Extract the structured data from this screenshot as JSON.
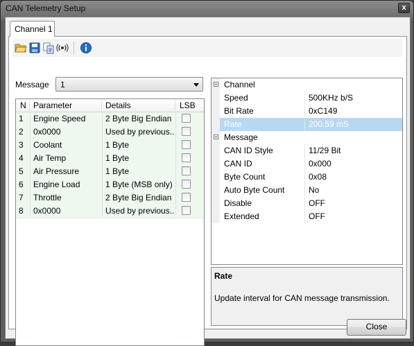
{
  "window": {
    "title": "CAN Telemetry Setup",
    "close_glyph": "x"
  },
  "tabs": [
    {
      "label": "Channel 1",
      "active": true
    }
  ],
  "toolbar": {
    "icons": [
      "open-folder-icon",
      "save-icon",
      "copy-icon",
      "broadcast-icon",
      "info-icon"
    ]
  },
  "message_selector": {
    "label": "Message",
    "value": "1"
  },
  "grid": {
    "columns": [
      "N",
      "Parameter",
      "Details",
      "LSB"
    ],
    "rows": [
      {
        "n": "1",
        "parameter": "Engine Speed",
        "details": "2 Byte Big Endian",
        "lsb": false
      },
      {
        "n": "2",
        "parameter": "0x0000",
        "details": "Used by previous...",
        "lsb": false
      },
      {
        "n": "3",
        "parameter": "Coolant",
        "details": "1 Byte",
        "lsb": false
      },
      {
        "n": "4",
        "parameter": "Air Temp",
        "details": "1 Byte",
        "lsb": false
      },
      {
        "n": "5",
        "parameter": "Air Pressure",
        "details": "1 Byte",
        "lsb": false
      },
      {
        "n": "6",
        "parameter": "Engine Load",
        "details": "1 Byte (MSB only)",
        "lsb": false
      },
      {
        "n": "7",
        "parameter": "Throttle",
        "details": "2 Byte Big Endian",
        "lsb": false
      },
      {
        "n": "8",
        "parameter": "0x0000",
        "details": "Used by previous...",
        "lsb": false
      }
    ]
  },
  "properties": {
    "channel": {
      "label": "Channel",
      "items": [
        {
          "name": "Speed",
          "value": "500KHz b/S"
        },
        {
          "name": "Bit Rate",
          "value": "0xC149"
        },
        {
          "name": "Rate",
          "value": "200.59 mS",
          "selected": true
        }
      ]
    },
    "message": {
      "label": "Message",
      "items": [
        {
          "name": "CAN ID Style",
          "value": "11/29 Bit"
        },
        {
          "name": "CAN ID",
          "value": "0x000"
        },
        {
          "name": "Byte Count",
          "value": "0x08"
        },
        {
          "name": "Auto Byte Count",
          "value": "No"
        },
        {
          "name": "Disable",
          "value": "OFF"
        },
        {
          "name": "Extended",
          "value": "OFF"
        }
      ]
    }
  },
  "help": {
    "title": "Rate",
    "description": "Update interval for CAN message transmission."
  },
  "buttons": {
    "close": "Close"
  },
  "colors": {
    "selection": "#b7d7f3",
    "grid_row": "#eef8ee",
    "info_blue": "#1f6fc4"
  }
}
